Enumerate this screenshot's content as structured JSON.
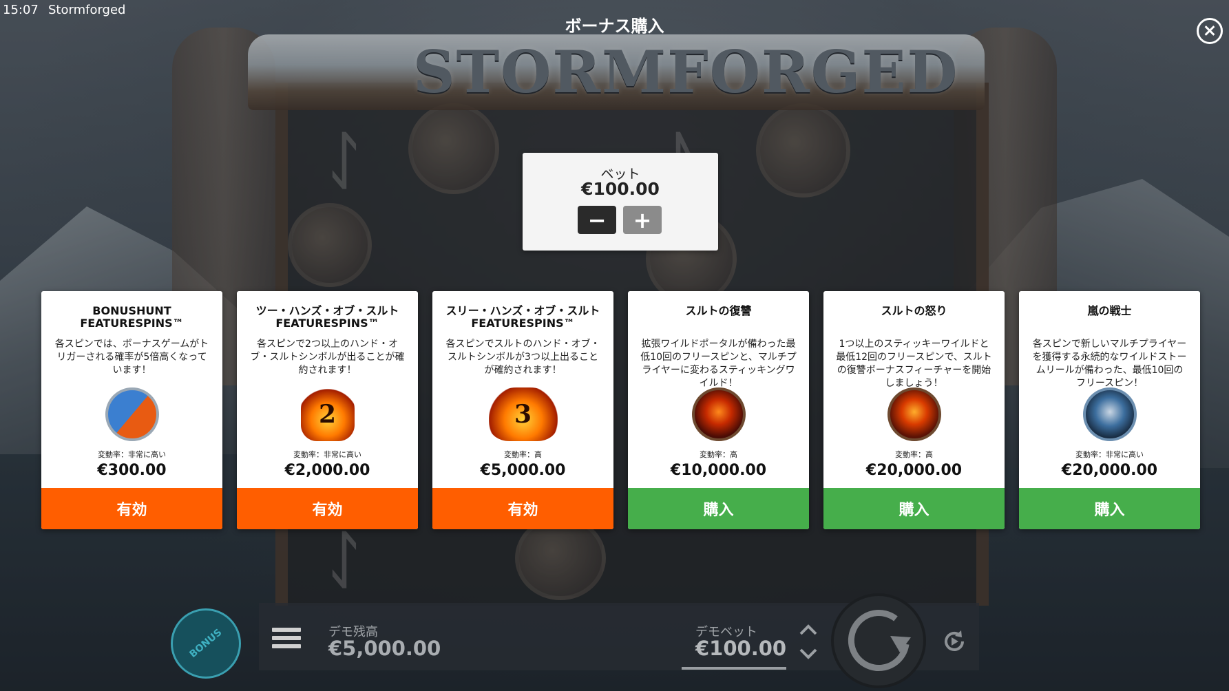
{
  "status_bar": {
    "time": "15:07",
    "app_name": "Stormforged"
  },
  "logo": {
    "text": "STORMFORGED"
  },
  "modal": {
    "title": "ボーナス購入",
    "close_icon": "close-icon"
  },
  "bet_selector": {
    "label": "ベット",
    "value": "€100.00",
    "minus_label": "−",
    "plus_label": "+"
  },
  "cards": [
    {
      "title": "BONUSHUNT FEATURESPINS™",
      "description": "各スピンでは、ボーナスゲームがトリガーされる確率が5倍高くなっています！",
      "icon": "bonushunt-icon",
      "volatility": "変動率：非常に高い",
      "price": "€300.00",
      "button": "有効",
      "button_color": "#ff5e00"
    },
    {
      "title": "ツー・ハンズ・オブ・スルトFEATURESPINS™",
      "description": "各スピンで2つ以上のハンド・オブ・スルトシンボルが出ることが確約されます！",
      "icon": "two-hands-icon",
      "icon_text": "2",
      "volatility": "変動率：非常に高い",
      "price": "€2,000.00",
      "button": "有効",
      "button_color": "#ff5e00"
    },
    {
      "title": "スリー・ハンズ・オブ・スルトFEATURESPINS™",
      "description": "各スピンでスルトのハンド・オブ・スルトシンボルが3つ以上出ることが確約されます！",
      "icon": "three-hands-icon",
      "icon_text": "3",
      "volatility": "変動率：高",
      "price": "€5,000.00",
      "button": "有効",
      "button_color": "#ff5e00"
    },
    {
      "title": "スルトの復讐",
      "description": "拡張ワイルドポータルが備わった最低10回のフリースピンと、マルチプライヤーに変わるスティッキングワイルド！",
      "icon": "surt-revenge-icon",
      "volatility": "変動率：高",
      "price": "€10,000.00",
      "button": "購入",
      "button_color": "#46ae4b"
    },
    {
      "title": "スルトの怒り",
      "description": "1つ以上のスティッキーワイルドと最低12回のフリースピンで、スルトの復讐ボーナスフィーチャーを開始しましょう！",
      "icon": "surt-rage-icon",
      "volatility": "変動率：高",
      "price": "€20,000.00",
      "button": "購入",
      "button_color": "#46ae4b"
    },
    {
      "title": "嵐の戦士",
      "description": "各スピンで新しいマルチプライヤーを獲得する永続的なワイルドストームリールが備わった、最低10回のフリースピン！",
      "icon": "storm-warrior-icon",
      "volatility": "変動率：非常に高い",
      "price": "€20,000.00",
      "button": "購入",
      "button_color": "#46ae4b"
    }
  ],
  "bottom_bar": {
    "bonus_label": "BONUS",
    "balance_label": "デモ残高",
    "balance_value": "€5,000.00",
    "bet_label": "デモベット",
    "bet_value": "€100.00"
  }
}
